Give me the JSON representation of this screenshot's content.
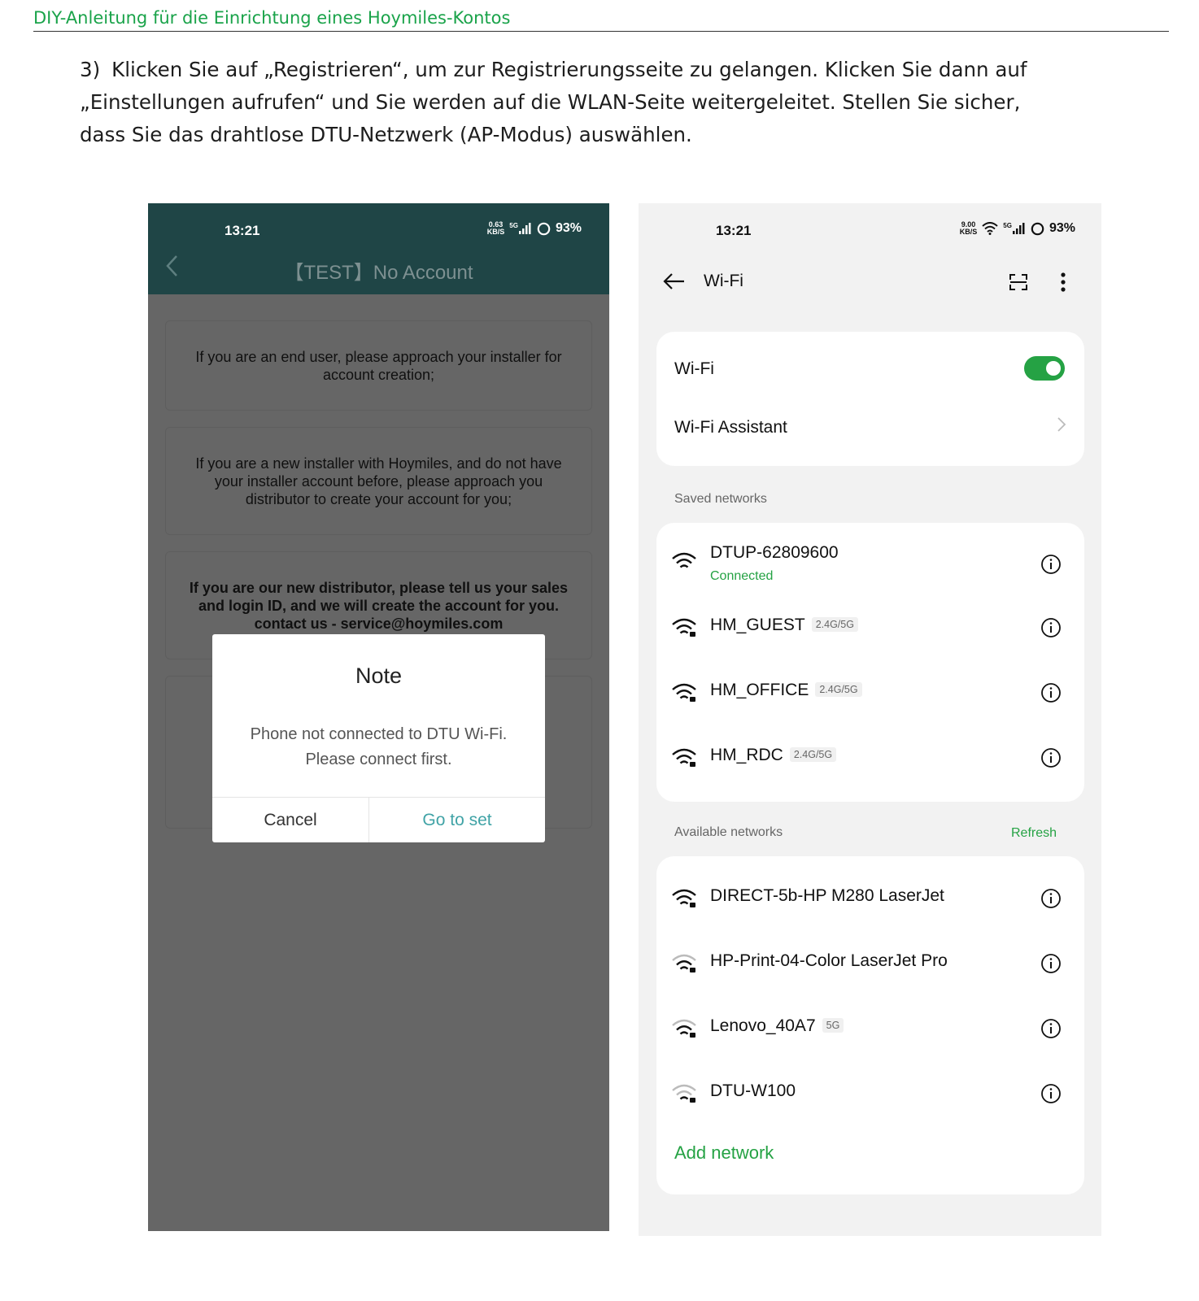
{
  "doc": {
    "header_title": "DIY-Anleitung für die Einrichtung eines Hoymiles-Kontos",
    "step_number": "3)",
    "step_lines": [
      "Klicken Sie auf „Registrieren“, um zur Registrierungsseite zu gelangen. Klicken Sie dann auf",
      "„Einstellungen aufrufen“ und Sie werden auf die WLAN-Seite weitergeleitet. Stellen Sie sicher,",
      "dass Sie das drahtlose DTU-Netzwerk (AP-Modus) auswählen."
    ]
  },
  "left_phone": {
    "status": {
      "time": "13:21",
      "speed_value": "0.63",
      "speed_unit": "KB/S",
      "network": "5G",
      "battery": "93%"
    },
    "title": "【TEST】No Account",
    "cards": [
      "If you are an end user, please approach your installer for account creation;",
      "If you are a new installer with Hoymiles, and do not have your installer account before, please approach you distributor to create your account for you;",
      "If you are our new distributor, please tell us your sales and login ID, and we will create the account for you. contact us - service@hoymiles.com"
    ],
    "dialog": {
      "title": "Note",
      "message_line1": "Phone not connected to DTU Wi-Fi.",
      "message_line2": "Please connect first.",
      "cancel_label": "Cancel",
      "confirm_label": "Go to set"
    }
  },
  "right_phone": {
    "status": {
      "time": "13:21",
      "speed_value": "9.00",
      "speed_unit": "KB/S",
      "network": "5G",
      "battery": "93%"
    },
    "title": "Wi-Fi",
    "wifi_toggle_label": "Wi-Fi",
    "wifi_enabled": true,
    "assistant_label": "Wi-Fi Assistant",
    "saved_label": "Saved networks",
    "saved_networks": [
      {
        "name": "DTUP-62809600",
        "status": "Connected",
        "band": ""
      },
      {
        "name": "HM_GUEST",
        "status": "",
        "band": "2.4G/5G"
      },
      {
        "name": "HM_OFFICE",
        "status": "",
        "band": "2.4G/5G"
      },
      {
        "name": "HM_RDC",
        "status": "",
        "band": "2.4G/5G"
      }
    ],
    "available_label": "Available networks",
    "refresh_label": "Refresh",
    "available_networks": [
      {
        "name": "DIRECT-5b-HP M280 LaserJet",
        "band": ""
      },
      {
        "name": "HP-Print-04-Color LaserJet Pro",
        "band": ""
      },
      {
        "name": "Lenovo_40A7",
        "band": "5G"
      },
      {
        "name": "DTU-W100",
        "band": ""
      }
    ],
    "add_network_label": "Add network"
  },
  "colors": {
    "accent_green": "#25a244",
    "header_green": "#1aa34a",
    "app_header": "#1f4546",
    "dialog_link": "#40a3a6"
  }
}
